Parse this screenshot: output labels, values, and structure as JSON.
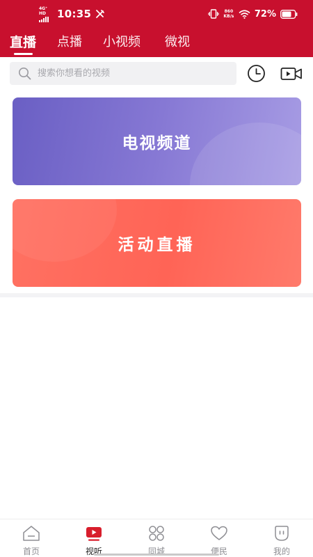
{
  "colors": {
    "brand_red": "#c8102e",
    "tv_card": "#7a6dcf",
    "live_card": "#ff6a5c",
    "nav_active": "#d81e2c"
  },
  "status_bar": {
    "network": "4G⁺ HD",
    "time": "10:35",
    "speed_top": "860",
    "speed_bottom": "KB/s",
    "battery": "72%"
  },
  "tabs": [
    {
      "label": "直播",
      "active": true
    },
    {
      "label": "点播",
      "active": false
    },
    {
      "label": "小视频",
      "active": false
    },
    {
      "label": "微视",
      "active": false
    }
  ],
  "search": {
    "placeholder": "搜索你想看的视频",
    "icon": "search-icon"
  },
  "toolbar": {
    "history_icon": "clock-icon",
    "video_icon": "video-camera-icon"
  },
  "cards": [
    {
      "label": "电视频道"
    },
    {
      "label": "活动直播"
    }
  ],
  "bottom_nav": [
    {
      "label": "首页",
      "icon": "home-icon",
      "active": false
    },
    {
      "label": "视听",
      "icon": "play-icon",
      "active": true
    },
    {
      "label": "同城",
      "icon": "grid-icon",
      "active": false
    },
    {
      "label": "便民",
      "icon": "heart-icon",
      "active": false
    },
    {
      "label": "我的",
      "icon": "profile-icon",
      "active": false
    }
  ]
}
